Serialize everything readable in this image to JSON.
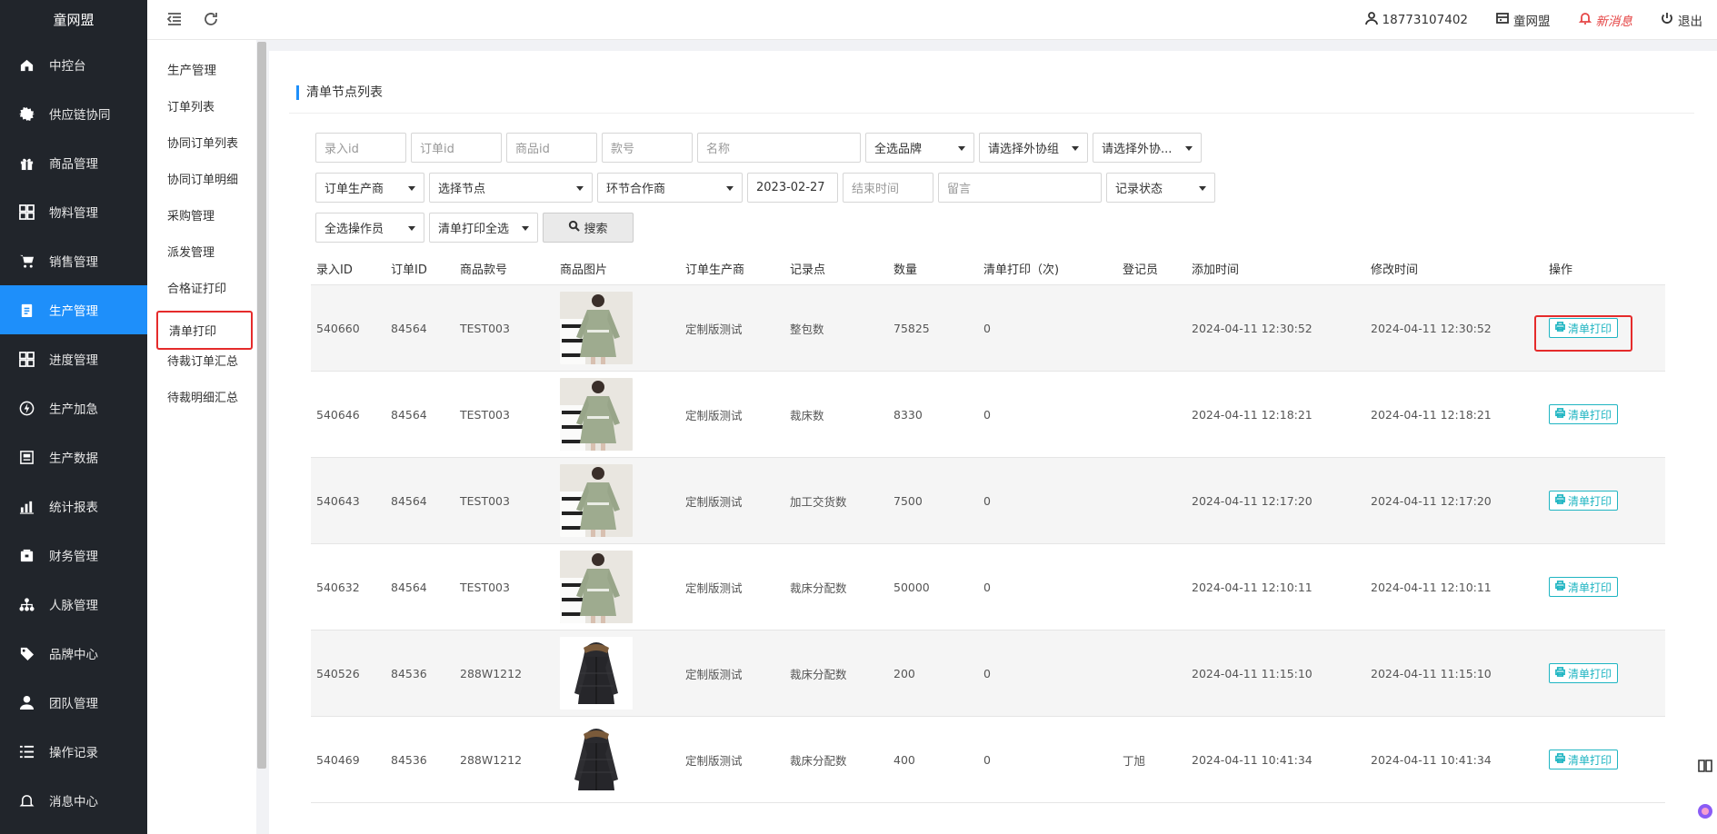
{
  "app": {
    "logo_text": "童网盟"
  },
  "sidebar": {
    "items": [
      {
        "label": "中控台",
        "icon": "home-icon"
      },
      {
        "label": "供应链协同",
        "icon": "gear-icon"
      },
      {
        "label": "商品管理",
        "icon": "gift-icon"
      },
      {
        "label": "物料管理",
        "icon": "grid-icon"
      },
      {
        "label": "销售管理",
        "icon": "cart-icon"
      },
      {
        "label": "生产管理",
        "icon": "clipboard-icon",
        "active": true
      },
      {
        "label": "进度管理",
        "icon": "grid-icon"
      },
      {
        "label": "生产加急",
        "icon": "bolt-icon"
      },
      {
        "label": "生产数据",
        "icon": "document-icon"
      },
      {
        "label": "统计报表",
        "icon": "bar-chart-icon"
      },
      {
        "label": "财务管理",
        "icon": "wallet-icon"
      },
      {
        "label": "人脉管理",
        "icon": "network-icon"
      },
      {
        "label": "品牌中心",
        "icon": "tag-icon"
      },
      {
        "label": "团队管理",
        "icon": "user-icon"
      },
      {
        "label": "操作记录",
        "icon": "list-icon"
      },
      {
        "label": "消息中心",
        "icon": "bell-icon"
      }
    ]
  },
  "topbar": {
    "phone": "18773107402",
    "store": "童网盟",
    "message": "新消息",
    "logout": "退出"
  },
  "submenu": {
    "title": "生产管理",
    "items": [
      "订单列表",
      "协同订单列表",
      "协同订单明细",
      "采购管理",
      "派发管理",
      "合格证打印",
      "清单打印",
      "待裁订单汇总",
      "待裁明细汇总"
    ],
    "active_index": 6
  },
  "page": {
    "section_title": "清单节点列表"
  },
  "filters": {
    "entry_id_placeholder": "录入id",
    "order_id_placeholder": "订单id",
    "product_id_placeholder": "商品id",
    "style_no_placeholder": "款号",
    "name_placeholder": "名称",
    "brand_select": "全选品牌",
    "outer_group_select": "请选择外协组",
    "outer_partner_select": "请选择外协...",
    "order_producer_select": "订单生产商",
    "node_select": "选择节点",
    "partner_select": "环节合作商",
    "start_date": "2023-02-27",
    "end_time_placeholder": "结束时间",
    "remark_placeholder": "留言",
    "record_status_select": "记录状态",
    "operator_select": "全选操作员",
    "print_select": "清单打印全选",
    "search_button": "搜索"
  },
  "table": {
    "headers": [
      "录入ID",
      "订单ID",
      "商品款号",
      "商品图片",
      "订单生产商",
      "记录点",
      "数量",
      "清单打印（次)",
      "登记员",
      "添加时间",
      "修改时间",
      "操作"
    ],
    "action_label": "清单打印",
    "rows": [
      {
        "entry_id": "540660",
        "order_id": "84564",
        "style_no": "TEST003",
        "image": "dress-photo",
        "producer": "定制版测试",
        "node": "整包数",
        "qty": "75825",
        "prints": "0",
        "clerk": "",
        "added": "2024-04-11 12:30:52",
        "modified": "2024-04-11 12:30:52"
      },
      {
        "entry_id": "540646",
        "order_id": "84564",
        "style_no": "TEST003",
        "image": "dress-photo",
        "producer": "定制版测试",
        "node": "裁床数",
        "qty": "8330",
        "prints": "0",
        "clerk": "",
        "added": "2024-04-11 12:18:21",
        "modified": "2024-04-11 12:18:21"
      },
      {
        "entry_id": "540643",
        "order_id": "84564",
        "style_no": "TEST003",
        "image": "dress-photo",
        "producer": "定制版测试",
        "node": "加工交货数",
        "qty": "7500",
        "prints": "0",
        "clerk": "",
        "added": "2024-04-11 12:17:20",
        "modified": "2024-04-11 12:17:20"
      },
      {
        "entry_id": "540632",
        "order_id": "84564",
        "style_no": "TEST003",
        "image": "dress-photo",
        "producer": "定制版测试",
        "node": "裁床分配数",
        "qty": "50000",
        "prints": "0",
        "clerk": "",
        "added": "2024-04-11 12:10:11",
        "modified": "2024-04-11 12:10:11"
      },
      {
        "entry_id": "540526",
        "order_id": "84536",
        "style_no": "288W1212",
        "image": "coat-photo",
        "producer": "定制版测试",
        "node": "裁床分配数",
        "qty": "200",
        "prints": "0",
        "clerk": "",
        "added": "2024-04-11 11:15:10",
        "modified": "2024-04-11 11:15:10"
      },
      {
        "entry_id": "540469",
        "order_id": "84536",
        "style_no": "288W1212",
        "image": "coat-photo",
        "producer": "定制版测试",
        "node": "裁床分配数",
        "qty": "400",
        "prints": "0",
        "clerk": "丁旭",
        "added": "2024-04-11 10:41:34",
        "modified": "2024-04-11 10:41:34"
      }
    ]
  },
  "colors": {
    "sidebar_bg": "#21252b",
    "accent": "#1e8ffa",
    "action": "#1fb5c2",
    "highlight": "#e52b2b"
  }
}
